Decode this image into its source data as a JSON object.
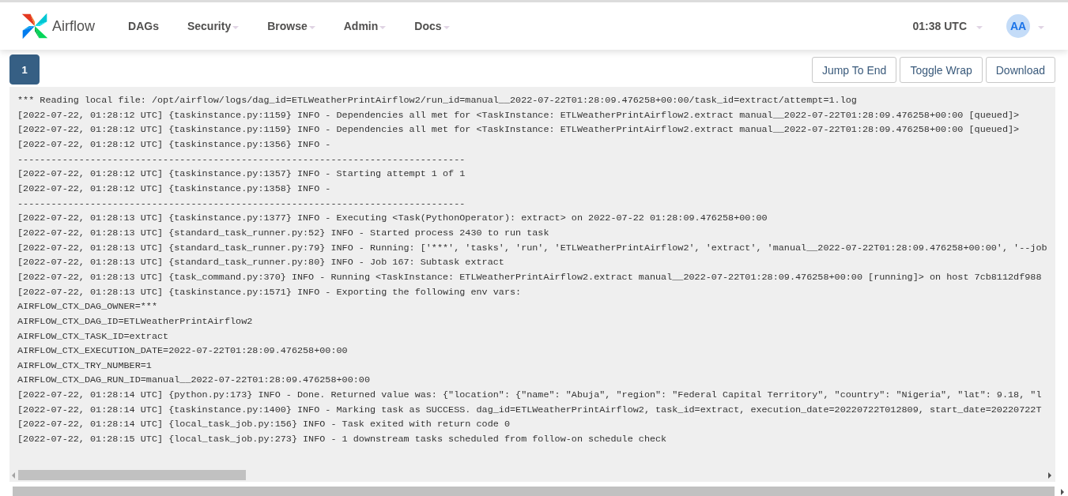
{
  "brand": "Airflow",
  "nav": [
    {
      "label": "DAGs",
      "dropdown": false
    },
    {
      "label": "Security",
      "dropdown": true
    },
    {
      "label": "Browse",
      "dropdown": true
    },
    {
      "label": "Admin",
      "dropdown": true
    },
    {
      "label": "Docs",
      "dropdown": true
    }
  ],
  "clock": {
    "label": "01:38 UTC",
    "dropdown": true
  },
  "user": {
    "initials": "AA",
    "dropdown": true
  },
  "attempts": [
    {
      "label": "1",
      "selected": true
    }
  ],
  "actions": [
    "Jump To End",
    "Toggle Wrap",
    "Download"
  ],
  "log_lines": [
    "*** Reading local file: /opt/airflow/logs/dag_id=ETLWeatherPrintAirflow2/run_id=manual__2022-07-22T01:28:09.476258+00:00/task_id=extract/attempt=1.log",
    "[2022-07-22, 01:28:12 UTC] {taskinstance.py:1159} INFO - Dependencies all met for <TaskInstance: ETLWeatherPrintAirflow2.extract manual__2022-07-22T01:28:09.476258+00:00 [queued]>",
    "[2022-07-22, 01:28:12 UTC] {taskinstance.py:1159} INFO - Dependencies all met for <TaskInstance: ETLWeatherPrintAirflow2.extract manual__2022-07-22T01:28:09.476258+00:00 [queued]>",
    "[2022-07-22, 01:28:12 UTC] {taskinstance.py:1356} INFO -",
    "--------------------------------------------------------------------------------",
    "[2022-07-22, 01:28:12 UTC] {taskinstance.py:1357} INFO - Starting attempt 1 of 1",
    "[2022-07-22, 01:28:12 UTC] {taskinstance.py:1358} INFO -",
    "--------------------------------------------------------------------------------",
    "[2022-07-22, 01:28:13 UTC] {taskinstance.py:1377} INFO - Executing <Task(PythonOperator): extract> on 2022-07-22 01:28:09.476258+00:00",
    "[2022-07-22, 01:28:13 UTC] {standard_task_runner.py:52} INFO - Started process 2430 to run task",
    "[2022-07-22, 01:28:13 UTC] {standard_task_runner.py:79} INFO - Running: ['***', 'tasks', 'run', 'ETLWeatherPrintAirflow2', 'extract', 'manual__2022-07-22T01:28:09.476258+00:00', '--job",
    "[2022-07-22, 01:28:13 UTC] {standard_task_runner.py:80} INFO - Job 167: Subtask extract",
    "[2022-07-22, 01:28:13 UTC] {task_command.py:370} INFO - Running <TaskInstance: ETLWeatherPrintAirflow2.extract manual__2022-07-22T01:28:09.476258+00:00 [running]> on host 7cb8112df988",
    "[2022-07-22, 01:28:13 UTC] {taskinstance.py:1571} INFO - Exporting the following env vars:",
    "AIRFLOW_CTX_DAG_OWNER=***",
    "AIRFLOW_CTX_DAG_ID=ETLWeatherPrintAirflow2",
    "AIRFLOW_CTX_TASK_ID=extract",
    "AIRFLOW_CTX_EXECUTION_DATE=2022-07-22T01:28:09.476258+00:00",
    "AIRFLOW_CTX_TRY_NUMBER=1",
    "AIRFLOW_CTX_DAG_RUN_ID=manual__2022-07-22T01:28:09.476258+00:00",
    "[2022-07-22, 01:28:14 UTC] {python.py:173} INFO - Done. Returned value was: {\"location\": {\"name\": \"Abuja\", \"region\": \"Federal Capital Territory\", \"country\": \"Nigeria\", \"lat\": 9.18, \"l",
    "[2022-07-22, 01:28:14 UTC] {taskinstance.py:1400} INFO - Marking task as SUCCESS. dag_id=ETLWeatherPrintAirflow2, task_id=extract, execution_date=20220722T012809, start_date=20220722T",
    "[2022-07-22, 01:28:14 UTC] {local_task_job.py:156} INFO - Task exited with return code 0",
    "[2022-07-22, 01:28:15 UTC] {local_task_job.py:273} INFO - 1 downstream tasks scheduled from follow-on schedule check"
  ]
}
